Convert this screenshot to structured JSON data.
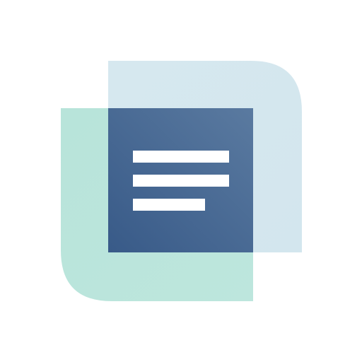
{
  "logo": {
    "icon": "document-lines-icon",
    "colors": {
      "background": "#ffffff",
      "back_sheet_light_blue": "#d6e8ef",
      "back_sheet_mint": "#b8e4da",
      "front_sheet_dark_start": "#385a88",
      "front_sheet_dark_end": "#5a7aa0",
      "text_lines": "#ffffff"
    }
  }
}
